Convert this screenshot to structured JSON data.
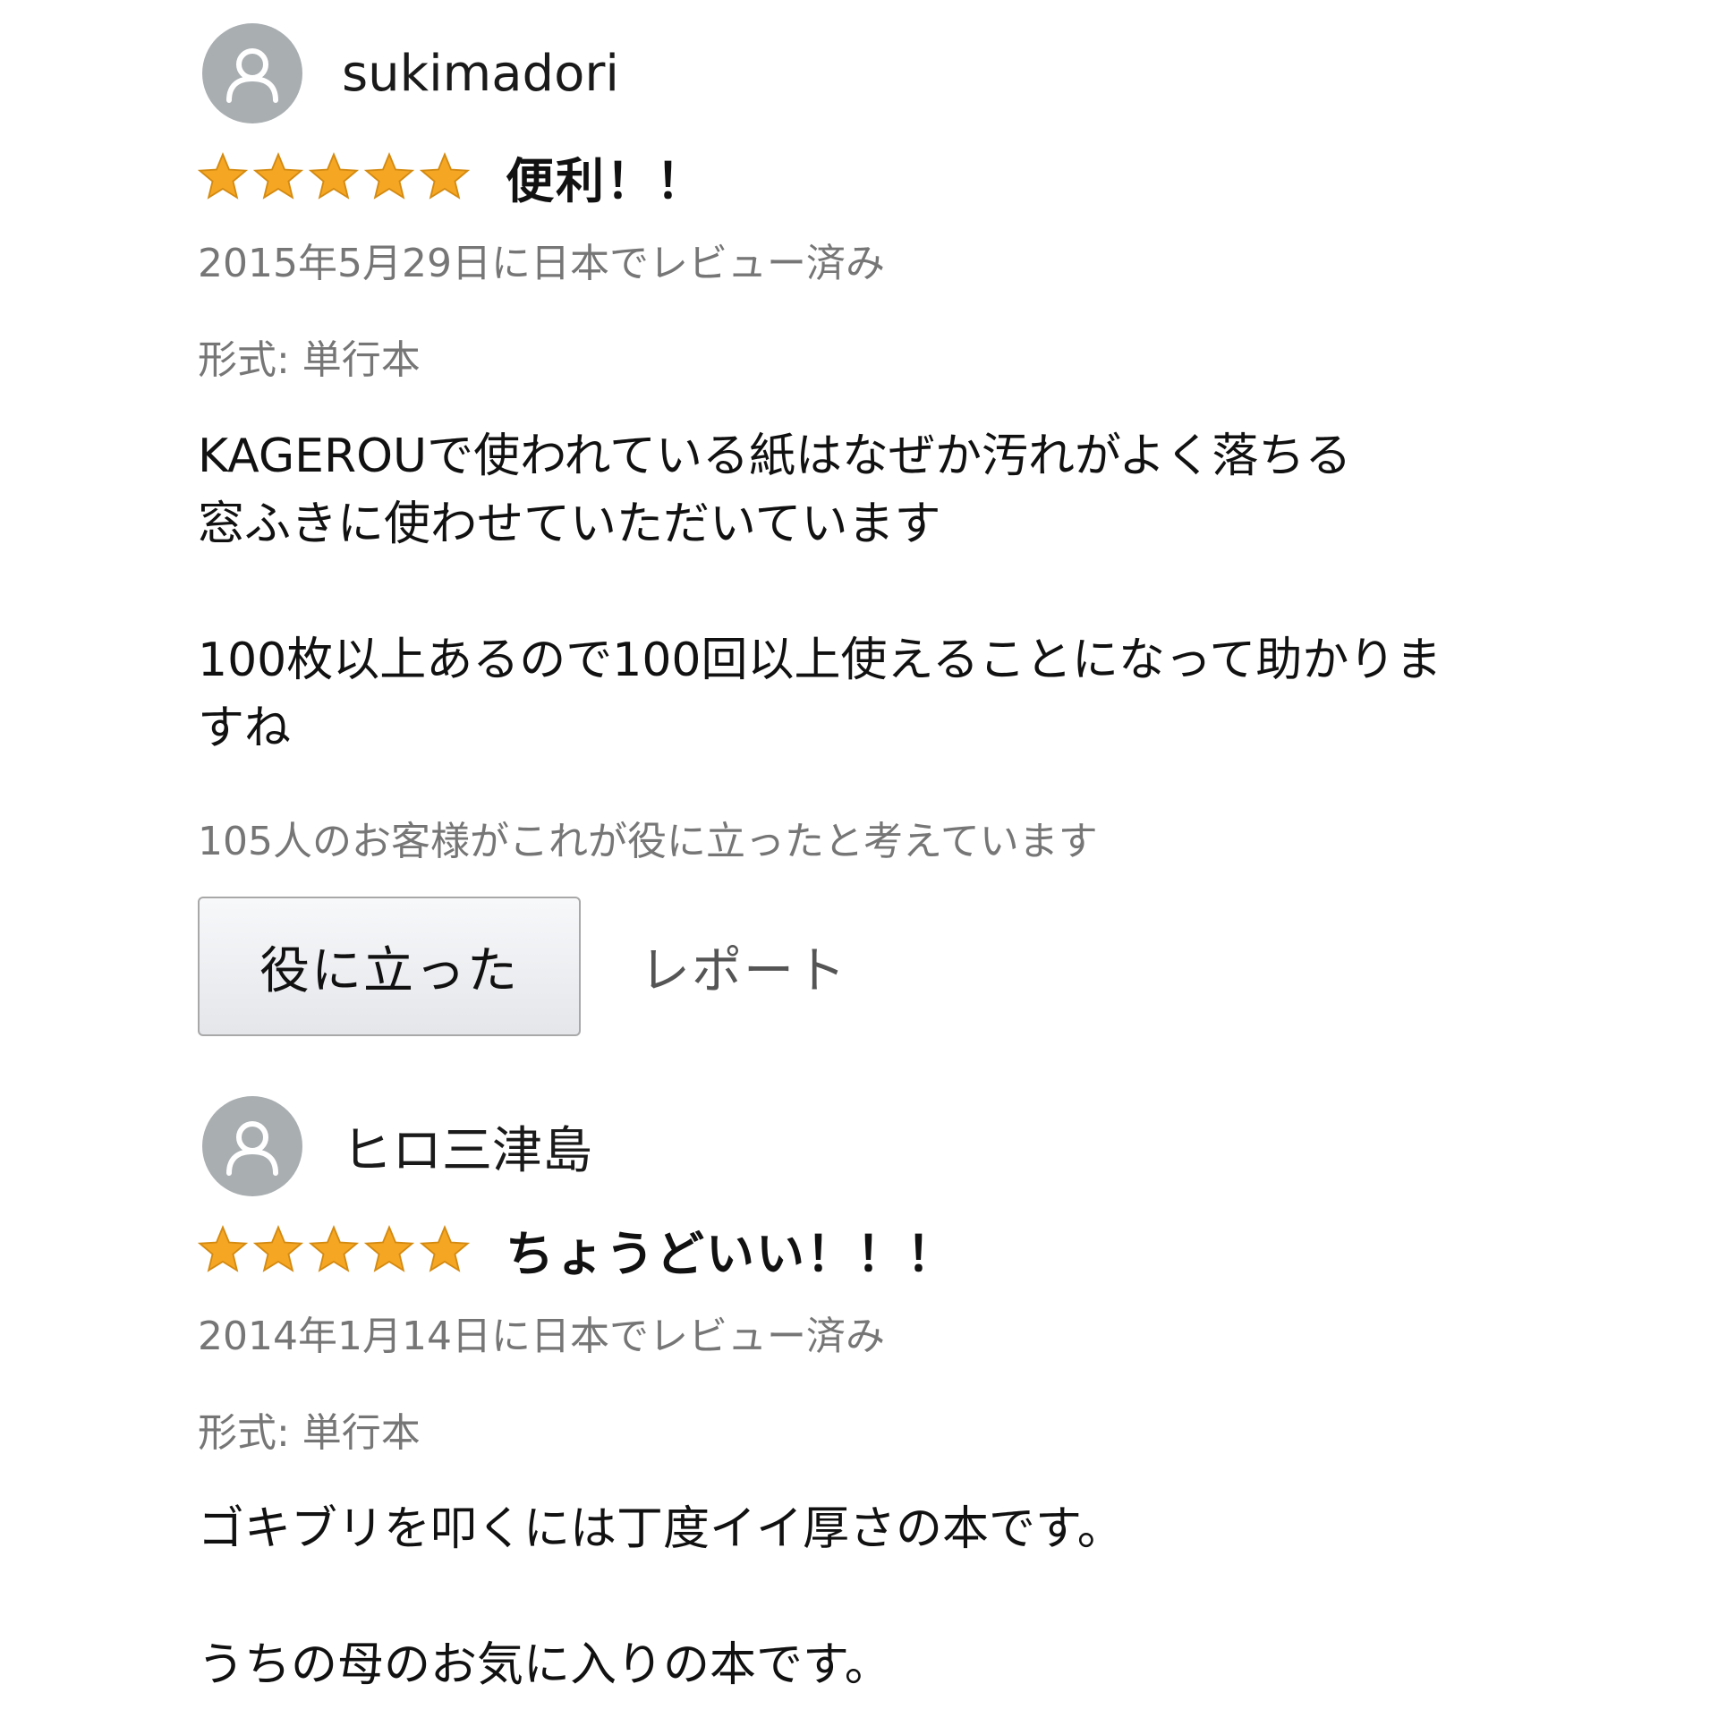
{
  "colors": {
    "star": "#f5a623",
    "avatar_bg": "#a9aeb1",
    "meta_text": "#767676",
    "body_text": "#111111"
  },
  "reviews": [
    {
      "reviewer": "sukimadori",
      "avatar_icon": "user-silhouette-icon",
      "rating": 5,
      "rating_max": 5,
      "title": "便利！！",
      "date": "2015年5月29日に日本でレビュー済み",
      "format": "形式: 単行本",
      "body": "KAGEROUで使われている紙はなぜか汚れがよく落ちる\n窓ふきに使わせていただいています\n\n100枚以上あるので100回以上使えることになって助かります\nね",
      "body_display": "KAGEROUで使われている紙はなぜか汚れがよく落ちる\n窓ふきに使わせていただいています\n\n100枚以上あるので100回以上使えることになって助かりま\nすね",
      "helpful_count": "105人のお客様がこれが役に立ったと考えています",
      "helpful_button": "役に立った",
      "report_link": "レポート"
    },
    {
      "reviewer": "ヒロ三津島",
      "avatar_icon": "user-silhouette-icon",
      "rating": 5,
      "rating_max": 5,
      "title": "ちょうどいい！！！",
      "date": "2014年1月14日に日本でレビュー済み",
      "format": "形式: 単行本",
      "body": "ゴキブリを叩くには丁度イイ厚さの本です。\n\nうちの母のお気に入りの本です。"
    }
  ]
}
